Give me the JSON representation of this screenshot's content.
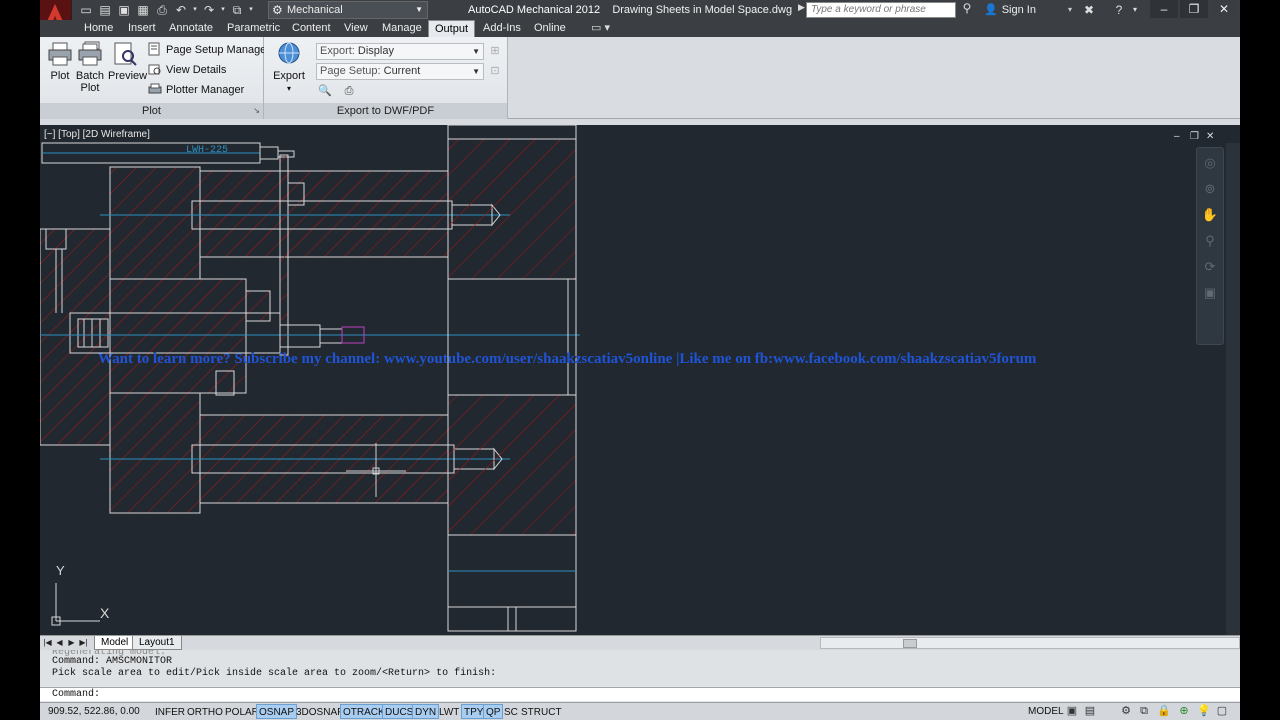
{
  "title_bar": {
    "workspace": "Mechanical",
    "app_name": "AutoCAD Mechanical 2012",
    "document_name": "Drawing Sheets in Model Space.dwg",
    "search_placeholder": "Type a keyword or phrase",
    "sign_in": "Sign In",
    "quick_access_icons": [
      "new-icon",
      "open-icon",
      "save-icon",
      "save-as-icon",
      "plot-icon",
      "undo-icon",
      "redo-icon",
      "workspace-icon"
    ]
  },
  "ribbon_tabs": [
    "Home",
    "Insert",
    "Annotate",
    "Parametric",
    "Content",
    "View",
    "Manage",
    "Output",
    "Add-Ins",
    "Online"
  ],
  "active_tab": "Output",
  "ribbon": {
    "plot_panel": {
      "title": "Plot",
      "plot_label": "Plot",
      "batch_plot_label": "Batch Plot",
      "preview_label": "Preview",
      "page_setup_manager": "Page Setup Manager",
      "view_details": "View Details",
      "plotter_manager": "Plotter Manager"
    },
    "export_panel": {
      "title": "Export to DWF/PDF",
      "export_label": "Export",
      "export_combo_label": "Export:",
      "export_combo_value": "Display",
      "page_setup_combo_label": "Page Setup:",
      "page_setup_combo_value": "Current"
    }
  },
  "viewport": {
    "label": "[−] [Top] [2D Wireframe]",
    "dimension_tag": "LWH-225",
    "overlay_text": "Want to learn more? Subscribe my channel: www.youtube.com/user/shaakzscatiav5online |Like me on fb:www.facebook.com/shaakzscatiav5forum",
    "ucs_x": "X",
    "ucs_y": "Y"
  },
  "layout_tabs": [
    "Model",
    "Layout1"
  ],
  "active_layout": "Model",
  "command_line": {
    "history": [
      "Regenerating model.",
      "Command: AMSCMONITOR",
      "Pick scale area to edit/Pick inside scale area to zoom/<Return> to finish:"
    ],
    "prompt": "Command:"
  },
  "status_bar": {
    "coordinates": "909.52, 522.86, 0.00",
    "toggles": [
      {
        "label": "INFER",
        "on": false
      },
      {
        "label": "ORTHO",
        "on": false
      },
      {
        "label": "POLAR",
        "on": false
      },
      {
        "label": "OSNAP",
        "on": true
      },
      {
        "label": "3DOSNAP",
        "on": false
      },
      {
        "label": "OTRACK",
        "on": true
      },
      {
        "label": "DUCS",
        "on": true
      },
      {
        "label": "DYN",
        "on": true
      },
      {
        "label": "LWT",
        "on": false
      },
      {
        "label": "TPY",
        "on": true
      },
      {
        "label": "QP",
        "on": true
      },
      {
        "label": "SC",
        "on": false
      },
      {
        "label": "STRUCT",
        "on": false
      }
    ],
    "model_label": "MODEL"
  }
}
